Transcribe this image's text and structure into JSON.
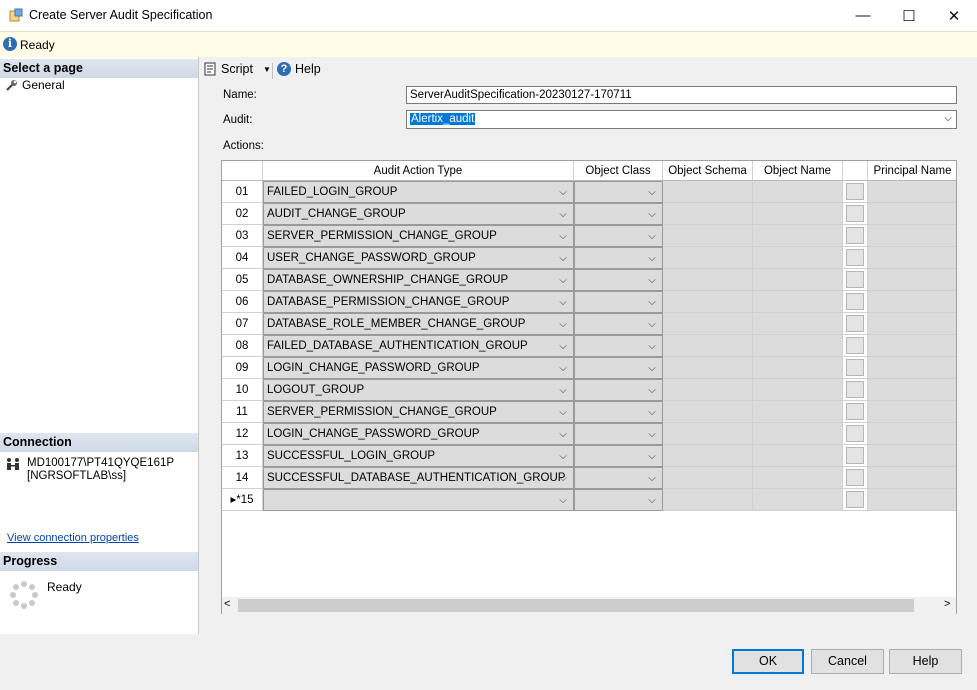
{
  "window": {
    "title": "Create Server Audit Specification",
    "minimize": "—",
    "maximize": "☐",
    "close": "✕"
  },
  "status": {
    "text": "Ready"
  },
  "left": {
    "select_page_header": "Select a page",
    "pages": [
      {
        "label": "General",
        "icon": "wrench-icon"
      }
    ],
    "connection_header": "Connection",
    "connection_server": "MD100177\\PT41QYQE161P",
    "connection_user": "[NGRSOFTLAB\\ss]",
    "view_connection_link": "View connection properties",
    "progress_header": "Progress",
    "progress_status": "Ready"
  },
  "toolbar": {
    "script_label": "Script",
    "help_label": "Help"
  },
  "form": {
    "name_label": "Name:",
    "name_value": "ServerAuditSpecification-20230127-170711",
    "audit_label": "Audit:",
    "audit_value": "Alertix_audit",
    "actions_label": "Actions:"
  },
  "grid": {
    "headers": {
      "audit_action_type": "Audit Action Type",
      "object_class": "Object Class",
      "object_schema": "Object Schema",
      "object_name": "Object Name",
      "principal_name": "Principal Name"
    },
    "rows": [
      {
        "num": "01",
        "action": "FAILED_LOGIN_GROUP"
      },
      {
        "num": "02",
        "action": "AUDIT_CHANGE_GROUP"
      },
      {
        "num": "03",
        "action": "SERVER_PERMISSION_CHANGE_GROUP"
      },
      {
        "num": "04",
        "action": "USER_CHANGE_PASSWORD_GROUP"
      },
      {
        "num": "05",
        "action": "DATABASE_OWNERSHIP_CHANGE_GROUP"
      },
      {
        "num": "06",
        "action": "DATABASE_PERMISSION_CHANGE_GROUP"
      },
      {
        "num": "07",
        "action": "DATABASE_ROLE_MEMBER_CHANGE_GROUP"
      },
      {
        "num": "08",
        "action": "FAILED_DATABASE_AUTHENTICATION_GROUP"
      },
      {
        "num": "09",
        "action": "LOGIN_CHANGE_PASSWORD_GROUP"
      },
      {
        "num": "10",
        "action": "LOGOUT_GROUP"
      },
      {
        "num": "11",
        "action": "SERVER_PERMISSION_CHANGE_GROUP"
      },
      {
        "num": "12",
        "action": "LOGIN_CHANGE_PASSWORD_GROUP"
      },
      {
        "num": "13",
        "action": "SUCCESSFUL_LOGIN_GROUP"
      },
      {
        "num": "14",
        "action": "SUCCESSFUL_DATABASE_AUTHENTICATION_GROUP"
      },
      {
        "num": "▸*15",
        "action": ""
      }
    ]
  },
  "buttons": {
    "ok": "OK",
    "cancel": "Cancel",
    "help": "Help"
  }
}
